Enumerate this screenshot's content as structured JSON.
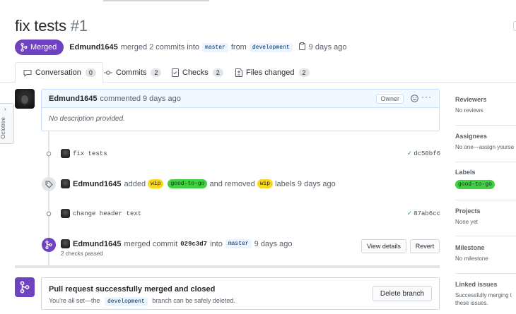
{
  "pr": {
    "title": "fix tests",
    "number": "#1",
    "status": "Merged",
    "author": "Edmund1645",
    "merge_text": "merged 2 commits into",
    "base_branch": "master",
    "from_text": "from",
    "head_branch": "development",
    "time": "9 days ago"
  },
  "tabs": [
    {
      "label": "Conversation",
      "count": "0"
    },
    {
      "label": "Commits",
      "count": "2"
    },
    {
      "label": "Checks",
      "count": "2"
    },
    {
      "label": "Files changed",
      "count": "2"
    }
  ],
  "octotree": {
    "label": "Octotree"
  },
  "comment": {
    "author": "Edmund1645",
    "meta": "commented 9 days ago",
    "role": "Owner",
    "body": "No description provided."
  },
  "timeline": {
    "commit1": {
      "message": "fix tests",
      "sha": "dc50bf6"
    },
    "labels_event": {
      "author": "Edmund1645",
      "added": "added",
      "added_labels": [
        "wip",
        "good-to-go"
      ],
      "removed": "and removed",
      "removed_label": "wip",
      "suffix": "labels 9 days ago"
    },
    "commit2": {
      "message": "change header text",
      "sha": "87ab6cc"
    },
    "merge_event": {
      "author": "Edmund1645",
      "text": "merged commit",
      "sha": "029c3d7",
      "into": "into",
      "branch": "master",
      "time": "9 days ago",
      "checks": "2 checks passed",
      "view_details": "View details",
      "revert": "Revert"
    }
  },
  "merge_box": {
    "title": "Pull request successfully merged and closed",
    "sub_prefix": "You're all set—the",
    "branch": "development",
    "sub_suffix": "branch can be safely deleted.",
    "delete_button": "Delete branch"
  },
  "sidebar": {
    "reviewers": {
      "heading": "Reviewers",
      "value": "No reviews"
    },
    "assignees": {
      "heading": "Assignees",
      "value": "No one—assign yourse"
    },
    "labels": {
      "heading": "Labels",
      "value": "good-to-go"
    },
    "projects": {
      "heading": "Projects",
      "value": "None yet"
    },
    "milestone": {
      "heading": "Milestone",
      "value": "No milestone"
    },
    "linked": {
      "heading": "Linked issues",
      "value": "Successfully merging t",
      "value2": "these issues."
    }
  },
  "colors": {
    "merged_purple": "#6f42c1",
    "label_wip": "#f9d71c",
    "label_good": "#3fd140",
    "check_green": "#28a745"
  }
}
